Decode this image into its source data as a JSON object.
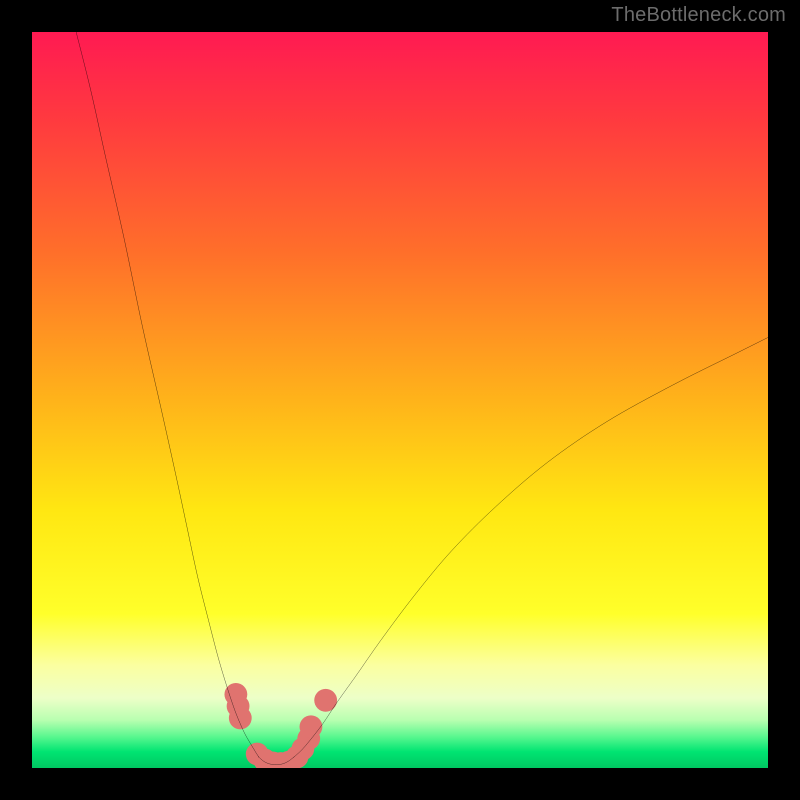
{
  "watermark": "TheBottleneck.com",
  "chart_data": {
    "type": "line",
    "title": "",
    "xlabel": "",
    "ylabel": "",
    "xlim": [
      0,
      100
    ],
    "ylim": [
      0,
      100
    ],
    "gradient_stops": [
      {
        "offset": 0,
        "color": "#ff1a52"
      },
      {
        "offset": 0.12,
        "color": "#ff3a3f"
      },
      {
        "offset": 0.3,
        "color": "#ff6f2a"
      },
      {
        "offset": 0.5,
        "color": "#ffb31a"
      },
      {
        "offset": 0.65,
        "color": "#ffe712"
      },
      {
        "offset": 0.79,
        "color": "#ffff2a"
      },
      {
        "offset": 0.86,
        "color": "#fbffa0"
      },
      {
        "offset": 0.905,
        "color": "#edffc8"
      },
      {
        "offset": 0.935,
        "color": "#b8ffb0"
      },
      {
        "offset": 0.958,
        "color": "#57f78e"
      },
      {
        "offset": 0.978,
        "color": "#00e472"
      },
      {
        "offset": 1.0,
        "color": "#00c862"
      }
    ],
    "series": [
      {
        "name": "left-branch",
        "x": [
          6.0,
          8.0,
          10.0,
          12.5,
          15.0,
          17.5,
          19.5,
          21.0,
          22.5,
          24.0,
          25.3,
          26.5,
          27.5,
          28.3,
          29.0,
          29.7,
          30.3,
          30.8
        ],
        "y": [
          100,
          92,
          83,
          72,
          60,
          49,
          40,
          33,
          26,
          20,
          15,
          11,
          8,
          6,
          4.5,
          3.3,
          2.3,
          1.5
        ]
      },
      {
        "name": "trough",
        "x": [
          30.8,
          31.5,
          32.3,
          33.2,
          34.0,
          34.8,
          35.6
        ],
        "y": [
          1.5,
          0.9,
          0.55,
          0.45,
          0.55,
          0.9,
          1.5
        ]
      },
      {
        "name": "right-branch",
        "x": [
          35.6,
          36.6,
          37.8,
          39.5,
          41.5,
          44.0,
          47.5,
          52.0,
          57.0,
          63.0,
          70.0,
          78.0,
          87.0,
          96.0,
          100.0
        ],
        "y": [
          1.5,
          2.4,
          3.8,
          6.0,
          9.0,
          12.5,
          17.5,
          23.5,
          29.5,
          35.5,
          41.5,
          47.0,
          52.0,
          56.5,
          58.5
        ]
      }
    ],
    "markers": {
      "name": "highlight-dots",
      "color": "#e0736f",
      "radius_pct": 1.55,
      "points": [
        {
          "x": 27.7,
          "y": 10.0
        },
        {
          "x": 28.0,
          "y": 8.4
        },
        {
          "x": 28.3,
          "y": 6.8
        },
        {
          "x": 30.6,
          "y": 1.9
        },
        {
          "x": 31.6,
          "y": 1.1
        },
        {
          "x": 32.7,
          "y": 0.7
        },
        {
          "x": 33.8,
          "y": 0.6
        },
        {
          "x": 34.9,
          "y": 0.8
        },
        {
          "x": 36.0,
          "y": 1.5
        },
        {
          "x": 36.8,
          "y": 2.6
        },
        {
          "x": 37.6,
          "y": 4.0
        },
        {
          "x": 37.9,
          "y": 5.6
        },
        {
          "x": 39.9,
          "y": 9.2
        }
      ]
    }
  }
}
